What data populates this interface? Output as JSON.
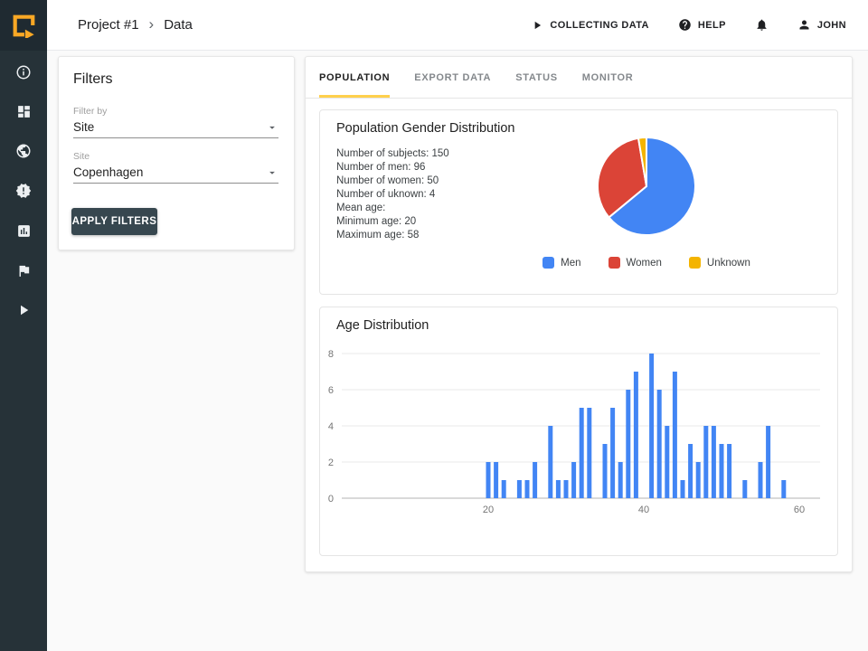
{
  "colors": {
    "brand_orange": "#f9a825",
    "tab_underline": "#ffd04d",
    "sidebar_bg": "#263238",
    "button_bg": "#37474f",
    "series_blue": "#4285f4",
    "series_red": "#db4437",
    "series_yellow": "#f4b400"
  },
  "topbar": {
    "breadcrumb": {
      "project": "Project #1",
      "separator": "›",
      "page": "Data"
    },
    "status_label": "COLLECTING DATA",
    "help_label": "HELP",
    "user_label": "JOHN"
  },
  "sidebar": {
    "items": [
      {
        "icon": "info-icon"
      },
      {
        "icon": "dashboard-icon"
      },
      {
        "icon": "globe-icon"
      },
      {
        "icon": "alert-badge-icon"
      },
      {
        "icon": "bar-chart-icon"
      },
      {
        "icon": "flag-icon"
      },
      {
        "icon": "play-icon"
      }
    ]
  },
  "filters": {
    "title": "Filters",
    "filter_by_label": "Filter by",
    "filter_by_value": "Site",
    "site_label": "Site",
    "site_value": "Copenhagen",
    "apply_button": "APPLY FILTERS"
  },
  "tabs": [
    {
      "label": "POPULATION",
      "active": true
    },
    {
      "label": "EXPORT DATA",
      "active": false
    },
    {
      "label": "STATUS",
      "active": false
    },
    {
      "label": "MONITOR",
      "active": false
    }
  ],
  "population": {
    "title": "Population Gender Distribution",
    "stats": [
      "Number of subjects: 150",
      "Number of men: 96",
      "Number of women: 50",
      "Number of uknown: 4",
      "Mean age:",
      "Minimum age: 20",
      "Maximum age: 58"
    ]
  },
  "age_distribution": {
    "title": "Age Distribution"
  },
  "chart_data": [
    {
      "type": "pie",
      "title": "Population Gender Distribution",
      "labels": [
        "Men",
        "Women",
        "Unknown"
      ],
      "values": [
        96,
        50,
        4
      ],
      "colors": [
        "#4285f4",
        "#db4437",
        "#f4b400"
      ],
      "legend_position": "bottom"
    },
    {
      "type": "bar",
      "title": "Age Distribution",
      "x": [
        20,
        21,
        22,
        24,
        25,
        26,
        28,
        29,
        30,
        31,
        32,
        33,
        35,
        36,
        37,
        38,
        39,
        41,
        42,
        43,
        44,
        45,
        46,
        47,
        48,
        49,
        50,
        51,
        53,
        55,
        56,
        58
      ],
      "values": [
        2,
        2,
        1,
        1,
        1,
        2,
        4,
        1,
        1,
        2,
        5,
        5,
        3,
        5,
        2,
        6,
        7,
        8,
        6,
        4,
        7,
        1,
        3,
        2,
        4,
        4,
        3,
        3,
        1,
        2,
        4,
        1
      ],
      "xlabel": "",
      "ylabel": "",
      "ylim": [
        0,
        8
      ],
      "yticks": [
        0,
        2,
        4,
        6,
        8
      ],
      "xticks": [
        20,
        40,
        60
      ],
      "bar_color": "#4285f4",
      "grid": true,
      "legend_position": "none"
    }
  ]
}
